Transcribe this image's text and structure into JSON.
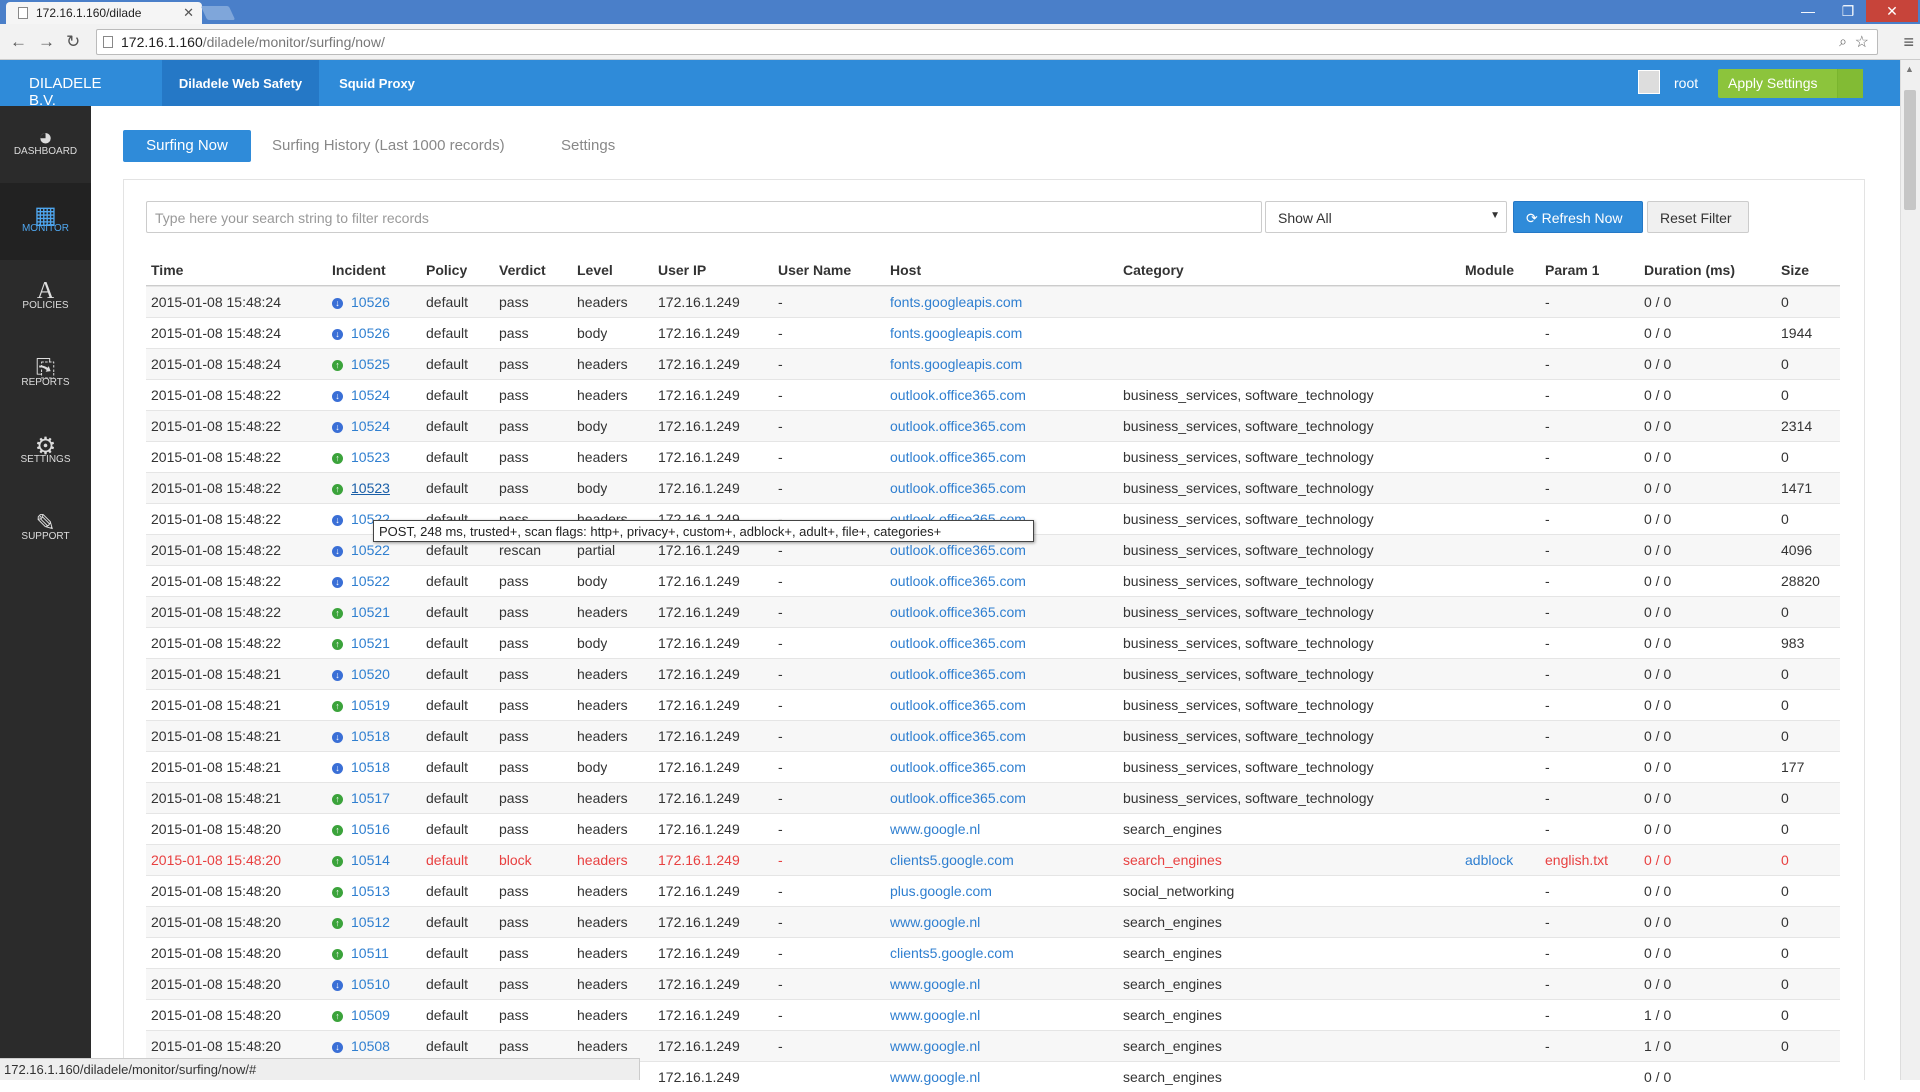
{
  "browser": {
    "tab_title": "172.16.1.160/dilade",
    "url_host": "172.16.1.160",
    "url_path": "/diladele/monitor/surfing/now/",
    "status_url": "172.16.1.160/diladele/monitor/surfing/now/#"
  },
  "header": {
    "brand": "DILADELE B.V.",
    "nav": [
      "Diladele Web Safety",
      "Squid Proxy"
    ],
    "user": "root",
    "apply": "Apply Settings"
  },
  "sidebar": {
    "items": [
      {
        "label": "DASHBOARD",
        "icon": "dashboard-icon"
      },
      {
        "label": "MONITOR",
        "icon": "monitor-icon"
      },
      {
        "label": "POLICIES",
        "icon": "policies-icon"
      },
      {
        "label": "REPORTS",
        "icon": "reports-icon"
      },
      {
        "label": "SETTINGS",
        "icon": "settings-icon"
      },
      {
        "label": "SUPPORT",
        "icon": "support-icon"
      }
    ]
  },
  "tabs": [
    "Surfing Now",
    "Surfing History (Last 1000 records)",
    "Settings"
  ],
  "filter": {
    "placeholder": "Type here your search string to filter records",
    "select": "Show All",
    "refresh": "Refresh Now",
    "reset": "Reset Filter"
  },
  "table": {
    "headers": [
      "Time",
      "Incident",
      "Policy",
      "Verdict",
      "Level",
      "User IP",
      "User Name",
      "Host",
      "Category",
      "Module",
      "Param 1",
      "Duration (ms)",
      "Size"
    ],
    "rows": [
      [
        "2015-01-08 15:48:24",
        "10526",
        "default",
        "pass",
        "headers",
        "172.16.1.249",
        "-",
        "fonts.googleapis.com",
        "",
        "",
        "-",
        "0 / 0",
        "0",
        "blue"
      ],
      [
        "2015-01-08 15:48:24",
        "10526",
        "default",
        "pass",
        "body",
        "172.16.1.249",
        "-",
        "fonts.googleapis.com",
        "",
        "",
        "-",
        "0 / 0",
        "1944",
        "blue"
      ],
      [
        "2015-01-08 15:48:24",
        "10525",
        "default",
        "pass",
        "headers",
        "172.16.1.249",
        "-",
        "fonts.googleapis.com",
        "",
        "",
        "-",
        "0 / 0",
        "0",
        "green"
      ],
      [
        "2015-01-08 15:48:22",
        "10524",
        "default",
        "pass",
        "headers",
        "172.16.1.249",
        "-",
        "outlook.office365.com",
        "business_services, software_technology",
        "",
        "-",
        "0 / 0",
        "0",
        "blue"
      ],
      [
        "2015-01-08 15:48:22",
        "10524",
        "default",
        "pass",
        "body",
        "172.16.1.249",
        "-",
        "outlook.office365.com",
        "business_services, software_technology",
        "",
        "-",
        "0 / 0",
        "2314",
        "blue"
      ],
      [
        "2015-01-08 15:48:22",
        "10523",
        "default",
        "pass",
        "headers",
        "172.16.1.249",
        "-",
        "outlook.office365.com",
        "business_services, software_technology",
        "",
        "-",
        "0 / 0",
        "0",
        "green"
      ],
      [
        "2015-01-08 15:48:22",
        "10523",
        "default",
        "pass",
        "body",
        "172.16.1.249",
        "-",
        "outlook.office365.com",
        "business_services, software_technology",
        "",
        "-",
        "0 / 0",
        "1471",
        "green"
      ],
      [
        "2015-01-08 15:48:22",
        "10522",
        "default",
        "pass",
        "headers",
        "172.16.1.249",
        "-",
        "outlook.office365.com",
        "business_services, software_technology",
        "",
        "-",
        "0 / 0",
        "0",
        "blue"
      ],
      [
        "2015-01-08 15:48:22",
        "10522",
        "default",
        "rescan",
        "partial",
        "172.16.1.249",
        "-",
        "outlook.office365.com",
        "business_services, software_technology",
        "",
        "-",
        "0 / 0",
        "4096",
        "blue"
      ],
      [
        "2015-01-08 15:48:22",
        "10522",
        "default",
        "pass",
        "body",
        "172.16.1.249",
        "-",
        "outlook.office365.com",
        "business_services, software_technology",
        "",
        "-",
        "0 / 0",
        "28820",
        "blue"
      ],
      [
        "2015-01-08 15:48:22",
        "10521",
        "default",
        "pass",
        "headers",
        "172.16.1.249",
        "-",
        "outlook.office365.com",
        "business_services, software_technology",
        "",
        "-",
        "0 / 0",
        "0",
        "green"
      ],
      [
        "2015-01-08 15:48:22",
        "10521",
        "default",
        "pass",
        "body",
        "172.16.1.249",
        "-",
        "outlook.office365.com",
        "business_services, software_technology",
        "",
        "-",
        "0 / 0",
        "983",
        "green"
      ],
      [
        "2015-01-08 15:48:21",
        "10520",
        "default",
        "pass",
        "headers",
        "172.16.1.249",
        "-",
        "outlook.office365.com",
        "business_services, software_technology",
        "",
        "-",
        "0 / 0",
        "0",
        "blue"
      ],
      [
        "2015-01-08 15:48:21",
        "10519",
        "default",
        "pass",
        "headers",
        "172.16.1.249",
        "-",
        "outlook.office365.com",
        "business_services, software_technology",
        "",
        "-",
        "0 / 0",
        "0",
        "green"
      ],
      [
        "2015-01-08 15:48:21",
        "10518",
        "default",
        "pass",
        "headers",
        "172.16.1.249",
        "-",
        "outlook.office365.com",
        "business_services, software_technology",
        "",
        "-",
        "0 / 0",
        "0",
        "blue"
      ],
      [
        "2015-01-08 15:48:21",
        "10518",
        "default",
        "pass",
        "body",
        "172.16.1.249",
        "-",
        "outlook.office365.com",
        "business_services, software_technology",
        "",
        "-",
        "0 / 0",
        "177",
        "blue"
      ],
      [
        "2015-01-08 15:48:21",
        "10517",
        "default",
        "pass",
        "headers",
        "172.16.1.249",
        "-",
        "outlook.office365.com",
        "business_services, software_technology",
        "",
        "-",
        "0 / 0",
        "0",
        "green"
      ],
      [
        "2015-01-08 15:48:20",
        "10516",
        "default",
        "pass",
        "headers",
        "172.16.1.249",
        "-",
        "www.google.nl",
        "search_engines",
        "",
        "-",
        "0 / 0",
        "0",
        "green"
      ],
      [
        "2015-01-08 15:48:20",
        "10514",
        "default",
        "block",
        "headers",
        "172.16.1.249",
        "-",
        "clients5.google.com",
        "search_engines",
        "adblock",
        "english.txt",
        "0 / 0",
        "0",
        "green"
      ],
      [
        "2015-01-08 15:48:20",
        "10513",
        "default",
        "pass",
        "headers",
        "172.16.1.249",
        "-",
        "plus.google.com",
        "social_networking",
        "",
        "-",
        "0 / 0",
        "0",
        "green"
      ],
      [
        "2015-01-08 15:48:20",
        "10512",
        "default",
        "pass",
        "headers",
        "172.16.1.249",
        "-",
        "www.google.nl",
        "search_engines",
        "",
        "-",
        "0 / 0",
        "0",
        "green"
      ],
      [
        "2015-01-08 15:48:20",
        "10511",
        "default",
        "pass",
        "headers",
        "172.16.1.249",
        "-",
        "clients5.google.com",
        "search_engines",
        "",
        "-",
        "0 / 0",
        "0",
        "green"
      ],
      [
        "2015-01-08 15:48:20",
        "10510",
        "default",
        "pass",
        "headers",
        "172.16.1.249",
        "-",
        "www.google.nl",
        "search_engines",
        "",
        "-",
        "0 / 0",
        "0",
        "blue"
      ],
      [
        "2015-01-08 15:48:20",
        "10509",
        "default",
        "pass",
        "headers",
        "172.16.1.249",
        "-",
        "www.google.nl",
        "search_engines",
        "",
        "-",
        "1 / 0",
        "0",
        "green"
      ],
      [
        "2015-01-08 15:48:20",
        "10508",
        "default",
        "pass",
        "headers",
        "172.16.1.249",
        "-",
        "www.google.nl",
        "search_engines",
        "",
        "-",
        "1 / 0",
        "0",
        "blue"
      ],
      [
        "",
        "",
        "",
        "",
        "",
        "172.16.1.249",
        "",
        "www.google.nl",
        "search_engines",
        "",
        "",
        "0 / 0",
        "",
        ""
      ]
    ]
  },
  "tooltip": "POST, 248 ms,  trusted+, scan flags: http+, privacy+, custom+, adblock+, adult+, file+, categories+"
}
